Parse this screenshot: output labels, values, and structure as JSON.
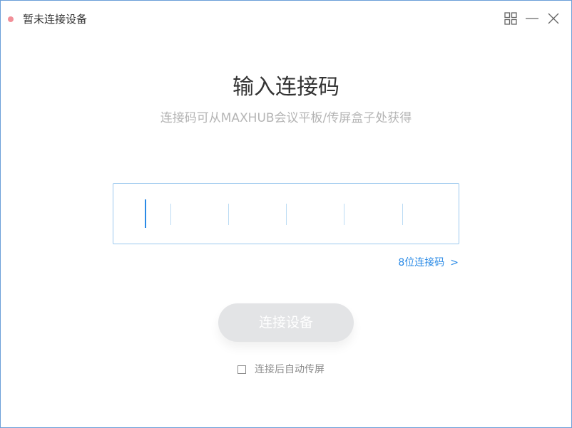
{
  "window": {
    "title": "暂未连接设备",
    "status_color": "#f28f98",
    "controls": [
      "grid-icon",
      "minimize-icon",
      "close-icon"
    ]
  },
  "main": {
    "heading": "输入连接码",
    "subheading": "连接码可从MAXHUB会议平板/传屏盒子处获得",
    "code_input": {
      "value": "",
      "cell_count": 6
    },
    "alt_code_link": {
      "label": "8位连接码",
      "chevron": ">"
    },
    "connect_button": {
      "label": "连接设备",
      "enabled": false
    },
    "auto_share": {
      "label": "连接后自动传屏",
      "checked": false
    }
  },
  "colors": {
    "accent": "#2a8ae6",
    "input_border": "#9cc9ee",
    "disabled_button": "#e3e4e6",
    "muted_text": "#b4b4b4"
  }
}
